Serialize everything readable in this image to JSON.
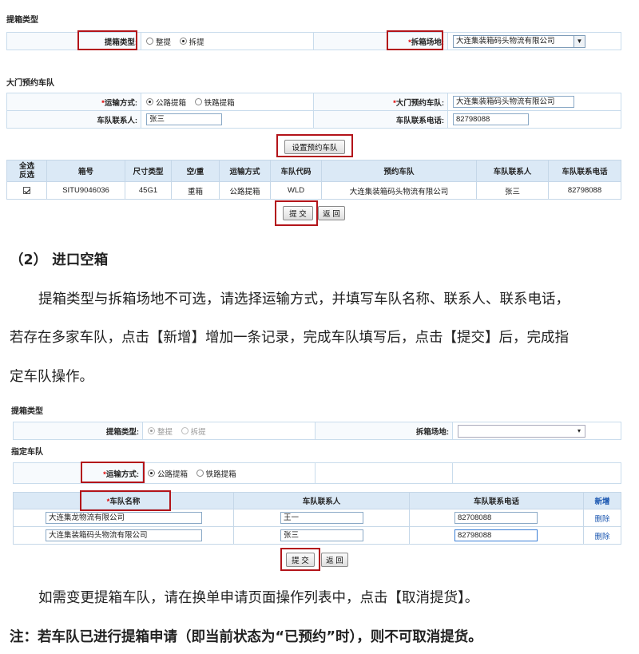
{
  "s1": {
    "section_title": "提箱类型",
    "pickup_type_label": "提箱类型:",
    "pickup_options": [
      "整提",
      "拆提"
    ],
    "pickup_selected": "拆提",
    "yard_label": "*拆箱场地:",
    "yard_value": "大连集装箱码头物流有限公司",
    "fleet_section_title": "大门预约车队",
    "transport_label": "*运输方式:",
    "transport_options": [
      "公路提箱",
      "铁路提箱"
    ],
    "transport_selected": "公路提箱",
    "gate_fleet_label": "*大门预约车队:",
    "gate_fleet_value": "大连集装箱码头物流有限公司",
    "contact_label": "车队联系人:",
    "contact_value": "张三",
    "phone_label": "车队联系电话:",
    "phone_value": "82798088",
    "set_fleet_button": "设置预约车队",
    "table": {
      "select_all": "全选",
      "invert": "反选",
      "headers": [
        "箱号",
        "尺寸类型",
        "空/重",
        "运输方式",
        "车队代码",
        "预约车队",
        "车队联系人",
        "车队联系电话"
      ],
      "rows": [
        {
          "checked": true,
          "cells": [
            "SITU9046036",
            "45G1",
            "重箱",
            "公路提箱",
            "WLD",
            "大连集装箱码头物流有限公司",
            "张三",
            "82798088"
          ]
        }
      ]
    },
    "submit_button": "提 交",
    "back_button": "返 回"
  },
  "doc": {
    "heading": "（2） 进口空箱",
    "p1_line1": "提箱类型与拆箱场地不可选，请选择运输方式，并填写车队名称、联系人、联系电话，",
    "p1_line2": "若存在多家车队，点击【新增】增加一条记录，完成车队填写后，点击【提交】后，完成指",
    "p1_line3": "定车队操作。",
    "p2": "如需变更提箱车队，请在换单申请页面操作列表中，点击【取消提货】。",
    "note": "注：若车队已进行提箱申请（即当前状态为“已预约”时），则不可取消提货。"
  },
  "s2": {
    "section_title": "提箱类型",
    "pickup_type_label": "提箱类型:",
    "pickup_options": [
      "整提",
      "拆提"
    ],
    "pickup_selected": "整提",
    "yard_label": "拆箱场地:",
    "yard_value": "",
    "fleet_section_title": "指定车队",
    "transport_label": "*运输方式:",
    "transport_options": [
      "公路提箱",
      "铁路提箱"
    ],
    "transport_selected": "公路提箱",
    "team_headers": {
      "name": "*车队名称",
      "contact": "车队联系人",
      "phone": "车队联系电话",
      "add": "新增"
    },
    "teams": [
      {
        "name": "大连集龙物流有限公司",
        "contact": "王一",
        "phone": "82708088",
        "delete": "删除"
      },
      {
        "name": "大连集装箱码头物流有限公司",
        "contact": "张三",
        "phone": "82798088",
        "delete": "删除"
      }
    ],
    "submit_button": "提 交",
    "back_button": "返 回"
  },
  "colors": {
    "highlight_border": "#b3141a",
    "header_bg": "#dbe9f6",
    "link": "#1a56b0"
  }
}
